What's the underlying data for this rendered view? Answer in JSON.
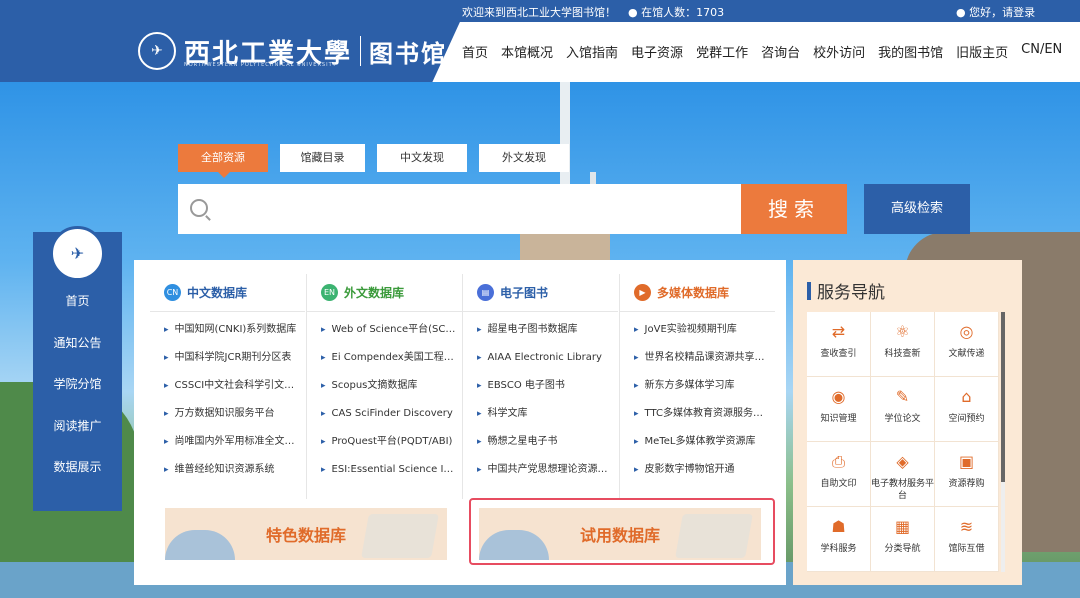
{
  "top": {
    "welcome": "欢迎来到西北工业大学图书馆！",
    "in_library": "在馆人数：1703",
    "login": "您好，请登录"
  },
  "logo": {
    "name": "西北工業大學",
    "sub": "NORTHWESTERN POLYTECHNICAL UNIVERSITY",
    "lib": "图书馆"
  },
  "nav": [
    "首页",
    "本馆概况",
    "入馆指南",
    "电子资源",
    "党群工作",
    "咨询台",
    "校外访问",
    "我的图书馆",
    "旧版主页",
    "CN/EN"
  ],
  "search": {
    "tabs": [
      "全部资源",
      "馆藏目录",
      "中文发现",
      "外文发现"
    ],
    "placeholder": "",
    "button": "搜索",
    "advanced": "高级检索"
  },
  "leftnav": [
    "首页",
    "通知公告",
    "学院分馆",
    "阅读推广",
    "数据展示"
  ],
  "columns": [
    {
      "badge": "CN",
      "badge_color": "#2f8fe0",
      "title": "中文数据库",
      "title_color": "#2c5fa8",
      "items": [
        "中国知网(CNKI)系列数据库",
        "中国科学院JCR期刊分区表",
        "CSSCI中文社会科学引文索引",
        "万方数据知识服务平台",
        "尚唯国内外军用标准全文数据库",
        "维普经纶知识资源系统"
      ]
    },
    {
      "badge": "EN",
      "badge_color": "#3cb371",
      "title": "外文数据库",
      "title_color": "#3a9a3a",
      "items": [
        "Web of Science平台(SCIE等)",
        "Ei Compendex美国工程索引",
        "Scopus文摘数据库",
        "CAS SciFinder Discovery",
        "ProQuest平台(PQDT/ABI)",
        "ESI:Essential Science Indicators"
      ]
    },
    {
      "badge": "▤",
      "badge_color": "#4a6fd8",
      "title": "电子图书",
      "title_color": "#2c5fa8",
      "items": [
        "超星电子图书数据库",
        "AIAA Electronic Library",
        "EBSCO 电子图书",
        "科学文库",
        "畅想之星电子书",
        "中国共产党思想理论资源数据库"
      ]
    },
    {
      "badge": "▶",
      "badge_color": "#e06b2a",
      "title": "多媒体数据库",
      "title_color": "#e06b2a",
      "items": [
        "JoVE实验视频期刊库",
        "世界名校精品课资源共享平台",
        "新东方多媒体学习库",
        "TTC多媒体教育资源服务平台",
        "MeTeL多媒体教学资源库",
        "皮影数字博物馆开通"
      ]
    }
  ],
  "banners": {
    "featured": "特色数据库",
    "trial": "试用数据库"
  },
  "service": {
    "title": "服务导航",
    "items": [
      {
        "icon": "⇄",
        "label": "查收查引"
      },
      {
        "icon": "⚛",
        "label": "科技查新"
      },
      {
        "icon": "◎",
        "label": "文献传递"
      },
      {
        "icon": "◉",
        "label": "知识管理"
      },
      {
        "icon": "✎",
        "label": "学位论文"
      },
      {
        "icon": "⌂",
        "label": "空间预约"
      },
      {
        "icon": "⎙",
        "label": "自助文印"
      },
      {
        "icon": "◈",
        "label": "电子教材服务平台"
      },
      {
        "icon": "▣",
        "label": "资源荐购"
      },
      {
        "icon": "☗",
        "label": "学科服务"
      },
      {
        "icon": "▦",
        "label": "分类导航"
      },
      {
        "icon": "≋",
        "label": "馆际互借"
      }
    ]
  }
}
